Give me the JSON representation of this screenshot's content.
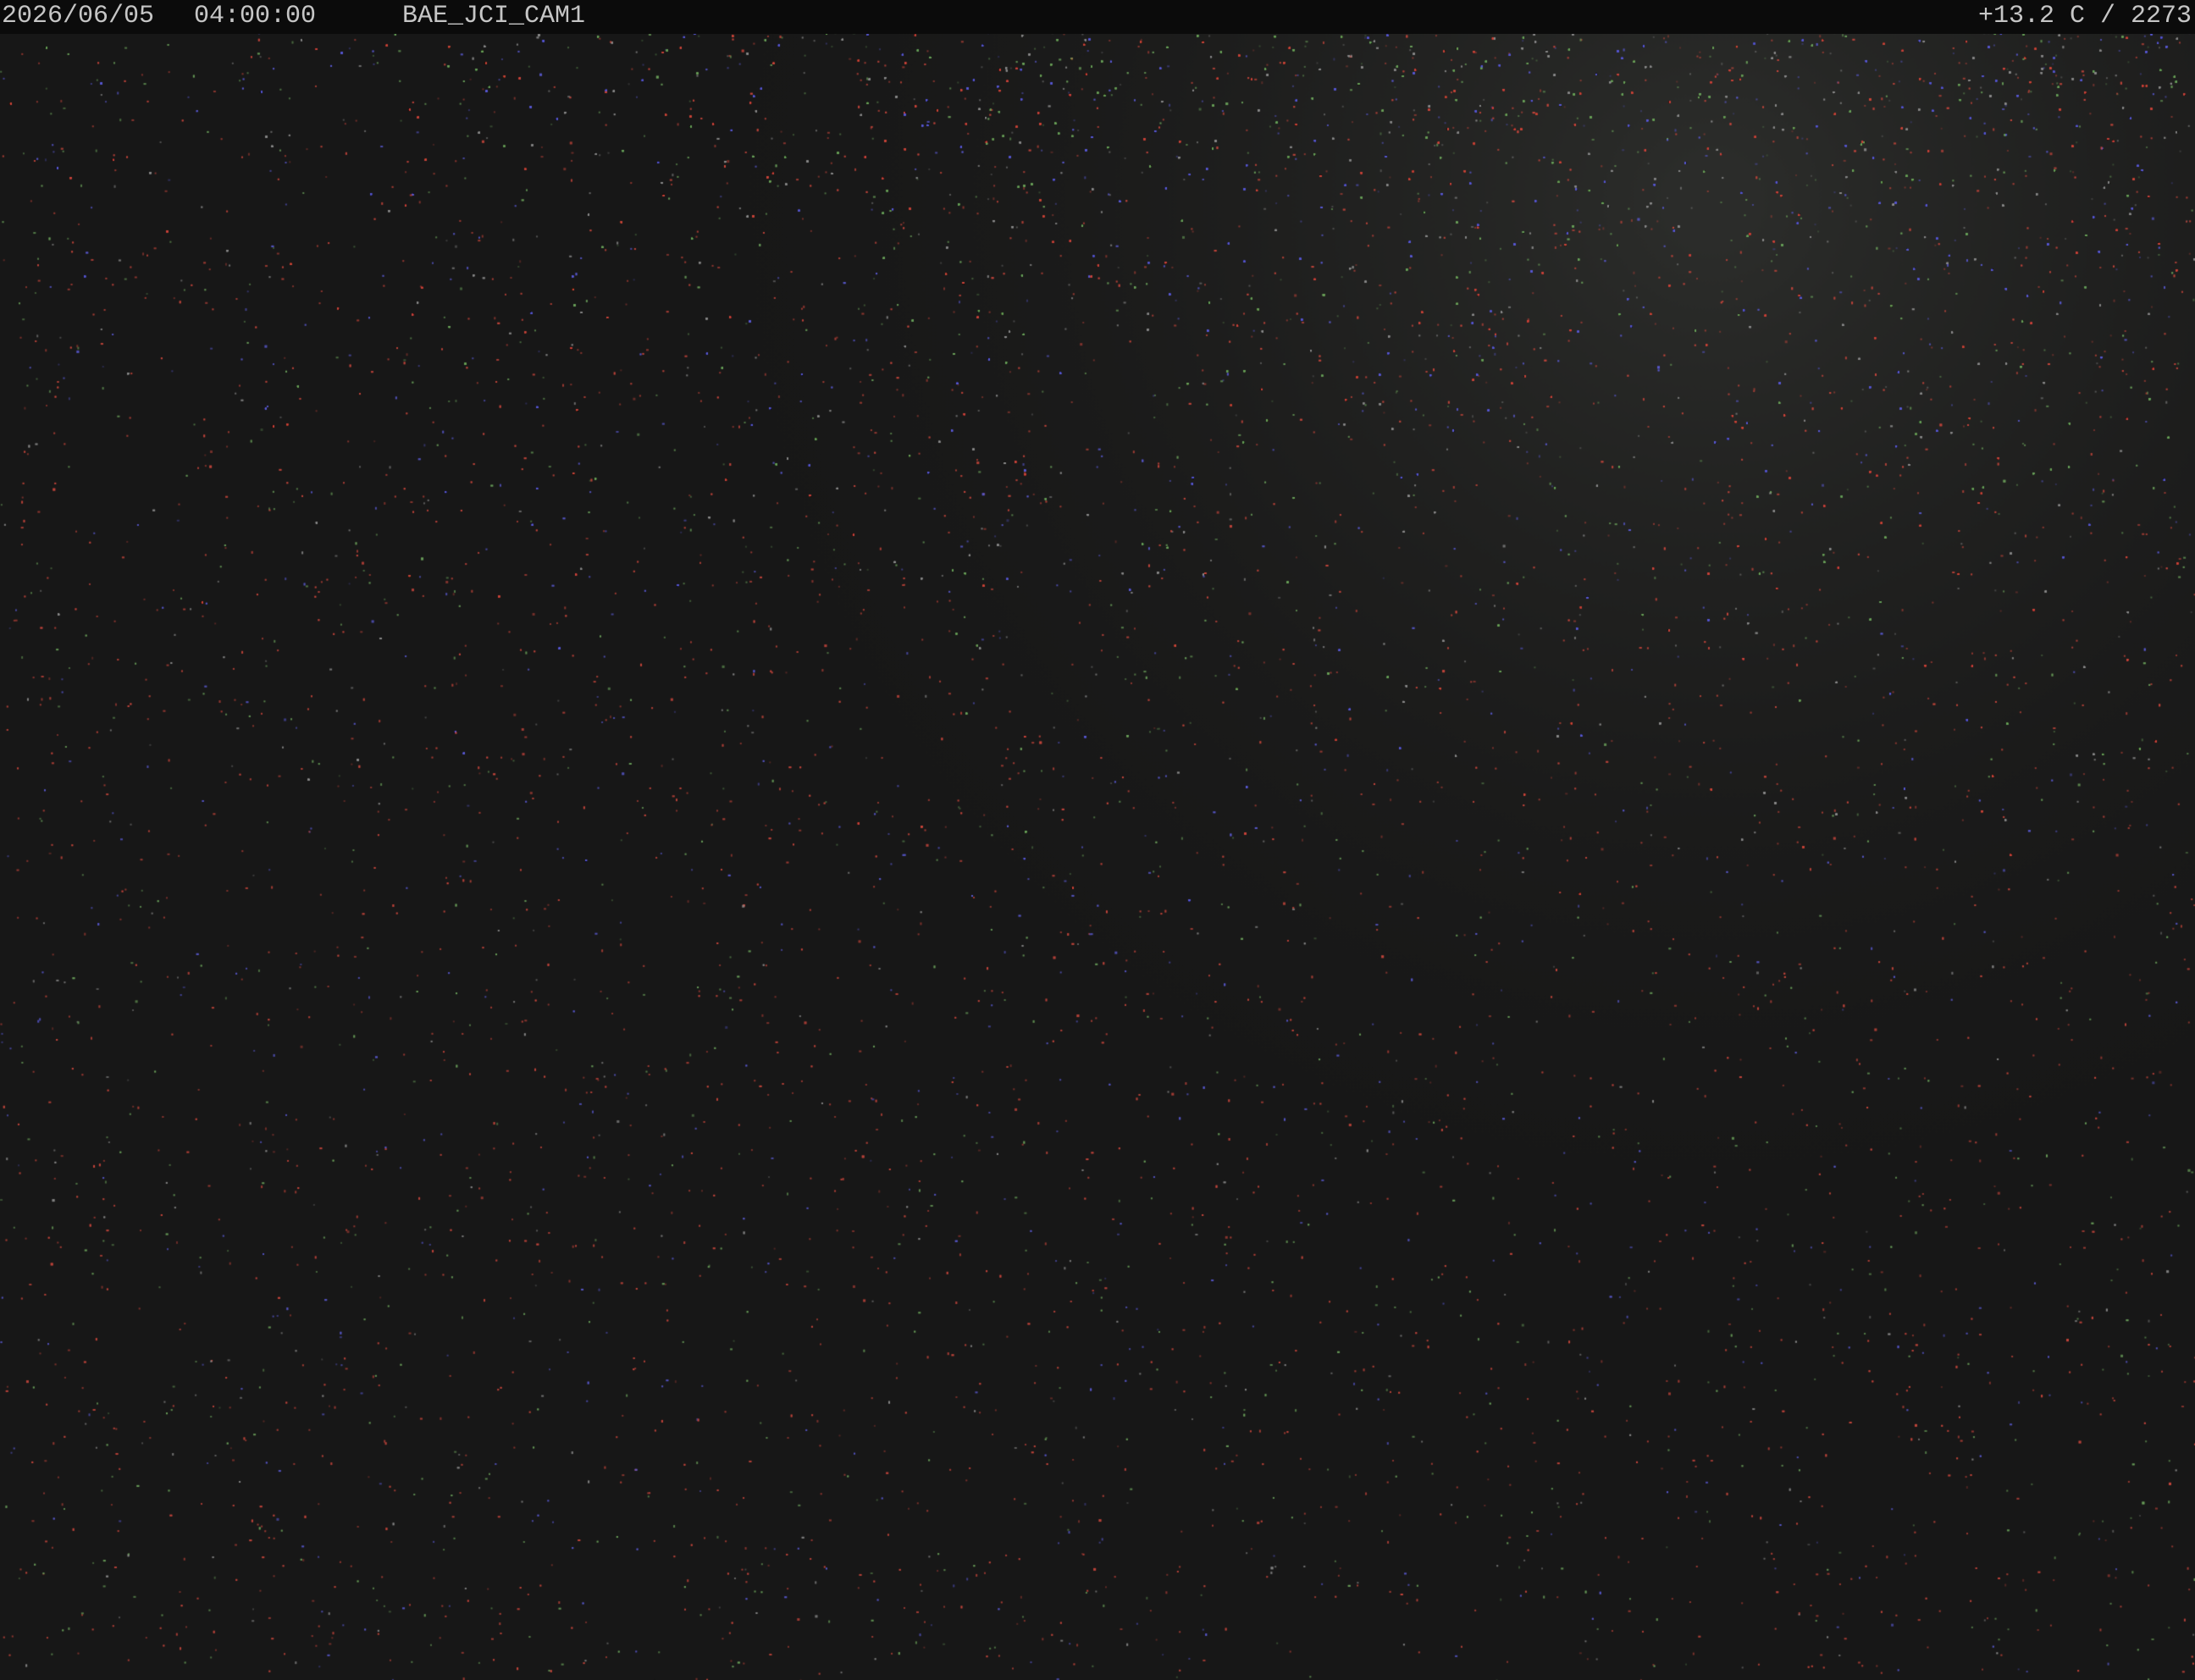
{
  "overlay": {
    "date": "2026/06/05",
    "time": "04:00:00",
    "camera_id": "BAE_JCI_CAM1",
    "sensor": "+13.2 C / 2273"
  },
  "colors": {
    "background": "#171717",
    "overlay_bar": "#0b0b0b",
    "overlay_text": "#c6c6c6",
    "noise_red": "#c8463c",
    "noise_green": "#6aa05a",
    "noise_blue": "#5a5ad2"
  },
  "scene": {
    "description_icon": "night-sky-noise-image"
  }
}
